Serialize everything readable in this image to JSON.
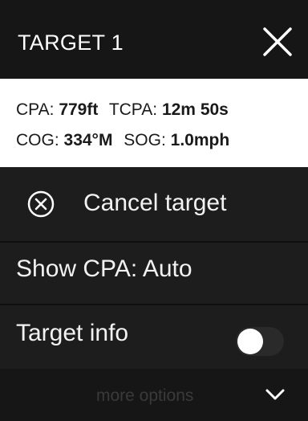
{
  "header": {
    "title": "TARGET 1"
  },
  "info": {
    "cpa_label": "CPA:",
    "cpa_value": "779ft",
    "tcpa_label": "TCPA:",
    "tcpa_value": "12m 50s",
    "cog_label": "COG:",
    "cog_value": "334°M",
    "sog_label": "SOG:",
    "sog_value": "1.0mph"
  },
  "menu": {
    "cancel_target": "Cancel target",
    "show_cpa": "Show CPA: Auto",
    "target_info": "Target info",
    "target_info_toggle_on": false,
    "more_options": "more options"
  },
  "icons": {
    "close": "close-icon",
    "cancel": "cancel-circle-icon",
    "more": "chevron-down-icon"
  },
  "colors": {
    "background": "#1d1d1d",
    "info_background": "#ffffff",
    "text": "#ffffff"
  }
}
